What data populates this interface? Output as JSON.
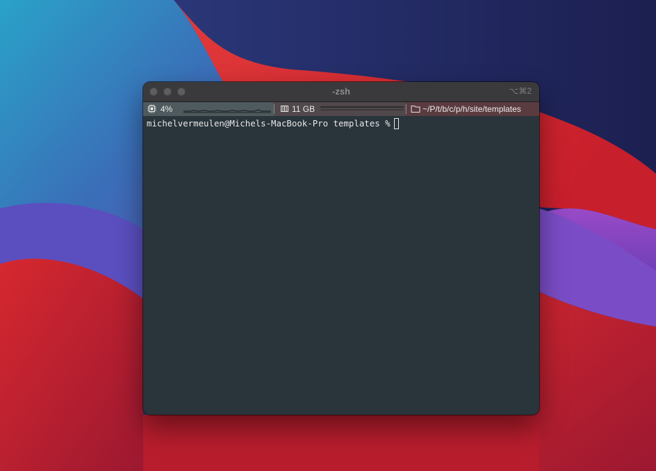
{
  "window": {
    "title": "-zsh",
    "shortcut": "⌥⌘2"
  },
  "statusbar": {
    "cpu": {
      "icon": "cpu-chip-icon",
      "value": "4%"
    },
    "memory": {
      "icon": "memory-module-icon",
      "value": "11 GB"
    },
    "path": {
      "icon": "folder-icon",
      "value": "~/P/t/b/c/p/h/site/templates"
    }
  },
  "terminal": {
    "prompt": "michelvermeulen@Michels-MacBook-Pro templates %"
  },
  "colors": {
    "terminal_bg": "#29343b",
    "titlebar_bg": "#3a3a3c",
    "cpu_segment": "#4e5a5d",
    "memory_segment": "#50484b",
    "path_segment": "#5a3b40"
  }
}
